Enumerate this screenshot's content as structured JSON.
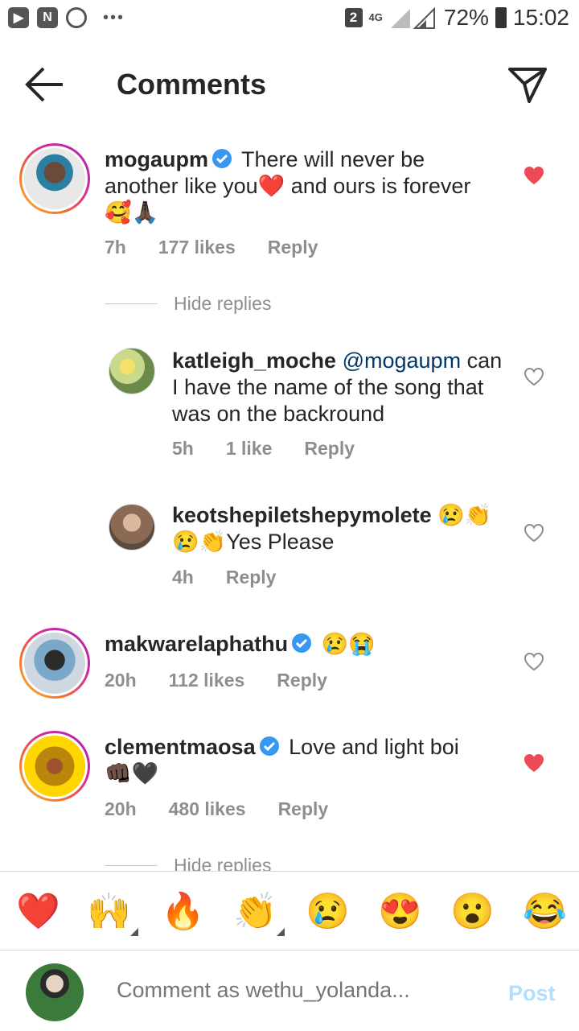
{
  "status_bar": {
    "sim_badge": "2",
    "network": "4G",
    "battery": "72%",
    "time": "15:02"
  },
  "header": {
    "title": "Comments"
  },
  "comments": [
    {
      "username": "mogaupm",
      "verified": true,
      "text_line1": "There will never be",
      "text_line2_a": "another like you",
      "text_line2_b": " and ours is forever",
      "text_line3": "🥰🙏🏿",
      "time": "7h",
      "likes": "177 likes",
      "reply": "Reply",
      "liked": true
    },
    {
      "username": "katleigh_moche",
      "mention": "@mogaupm",
      "text_line1": "can",
      "text_line2": "I have the name of the song that",
      "text_line3": "was on the backround",
      "time": "5h",
      "likes": "1 like",
      "reply": "Reply",
      "liked": false
    },
    {
      "username": "keotshepiletshepymolete",
      "text_line1": "😢👏",
      "text_line2": "😢👏Yes Please",
      "time": "4h",
      "reply": "Reply",
      "liked": false
    },
    {
      "username": "makwarelaphathu",
      "verified": true,
      "text_line1": "😢😭",
      "time": "20h",
      "likes": "112 likes",
      "reply": "Reply",
      "liked": false
    },
    {
      "username": "clementmaosa",
      "verified": true,
      "text_line1": "Love and light boi",
      "text_line2": "👊🏿🖤",
      "time": "20h",
      "likes": "480 likes",
      "reply": "Reply",
      "liked": true
    }
  ],
  "hide_replies": [
    "Hide replies",
    "Hide replies"
  ],
  "quick_emojis": [
    "❤️",
    "🙌",
    "🔥",
    "👏",
    "😢",
    "😍",
    "😮",
    "😂"
  ],
  "composer": {
    "placeholder": "Comment as wethu_yolanda...",
    "post_label": "Post"
  },
  "colors": {
    "like_red": "#ed4956",
    "verified_blue": "#3897f0",
    "post_disabled": "#b2dffc",
    "meta_gray": "#8e8e8e"
  }
}
